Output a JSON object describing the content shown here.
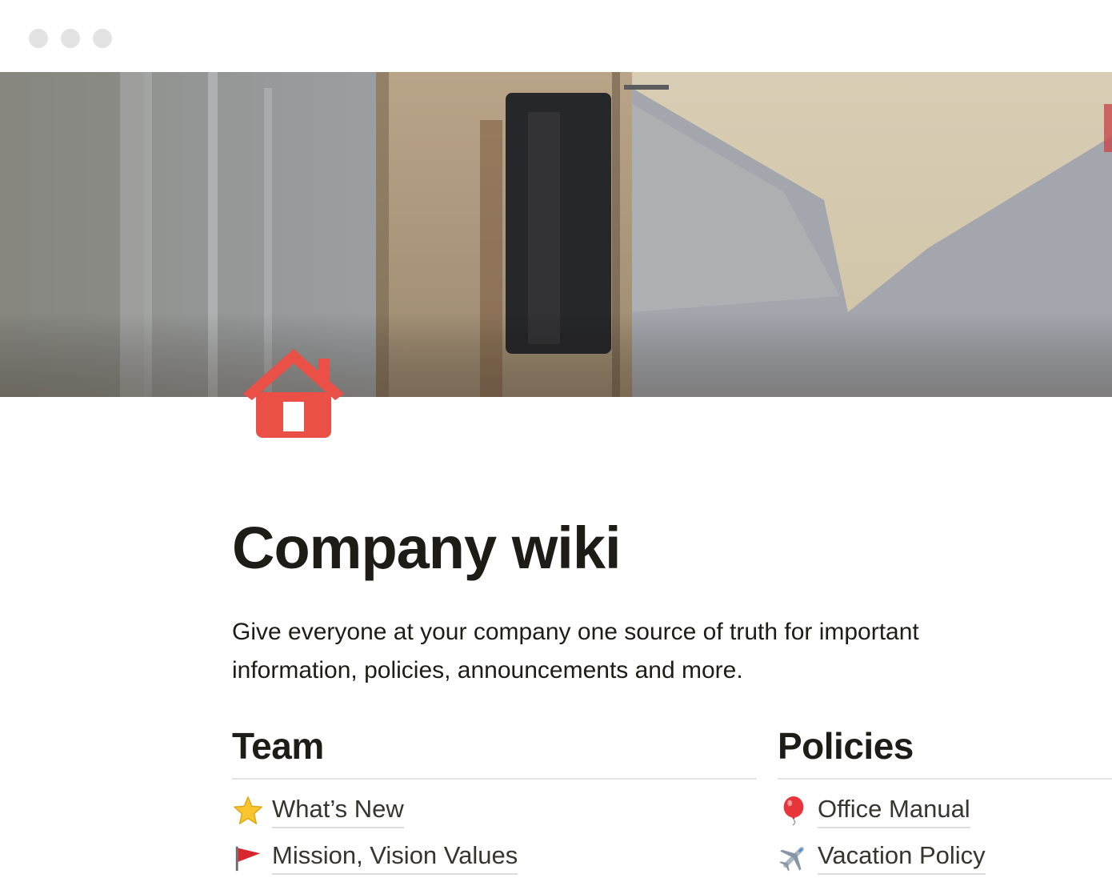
{
  "page": {
    "title": "Company wiki",
    "description": "Give everyone at your company one source of truth for important information, policies, announcements and more.",
    "icon": "house-icon",
    "accent_color": "#eb5047"
  },
  "columns": {
    "team": {
      "heading": "Team",
      "links": [
        {
          "label": "What’s New",
          "icon": "star-icon"
        },
        {
          "label": "Mission, Vision Values",
          "icon": "red-flag-icon"
        }
      ]
    },
    "policies": {
      "heading": "Policies",
      "links": [
        {
          "label": "Office Manual",
          "icon": "balloon-icon"
        },
        {
          "label": "Vacation Policy",
          "icon": "airplane-icon"
        }
      ]
    }
  }
}
